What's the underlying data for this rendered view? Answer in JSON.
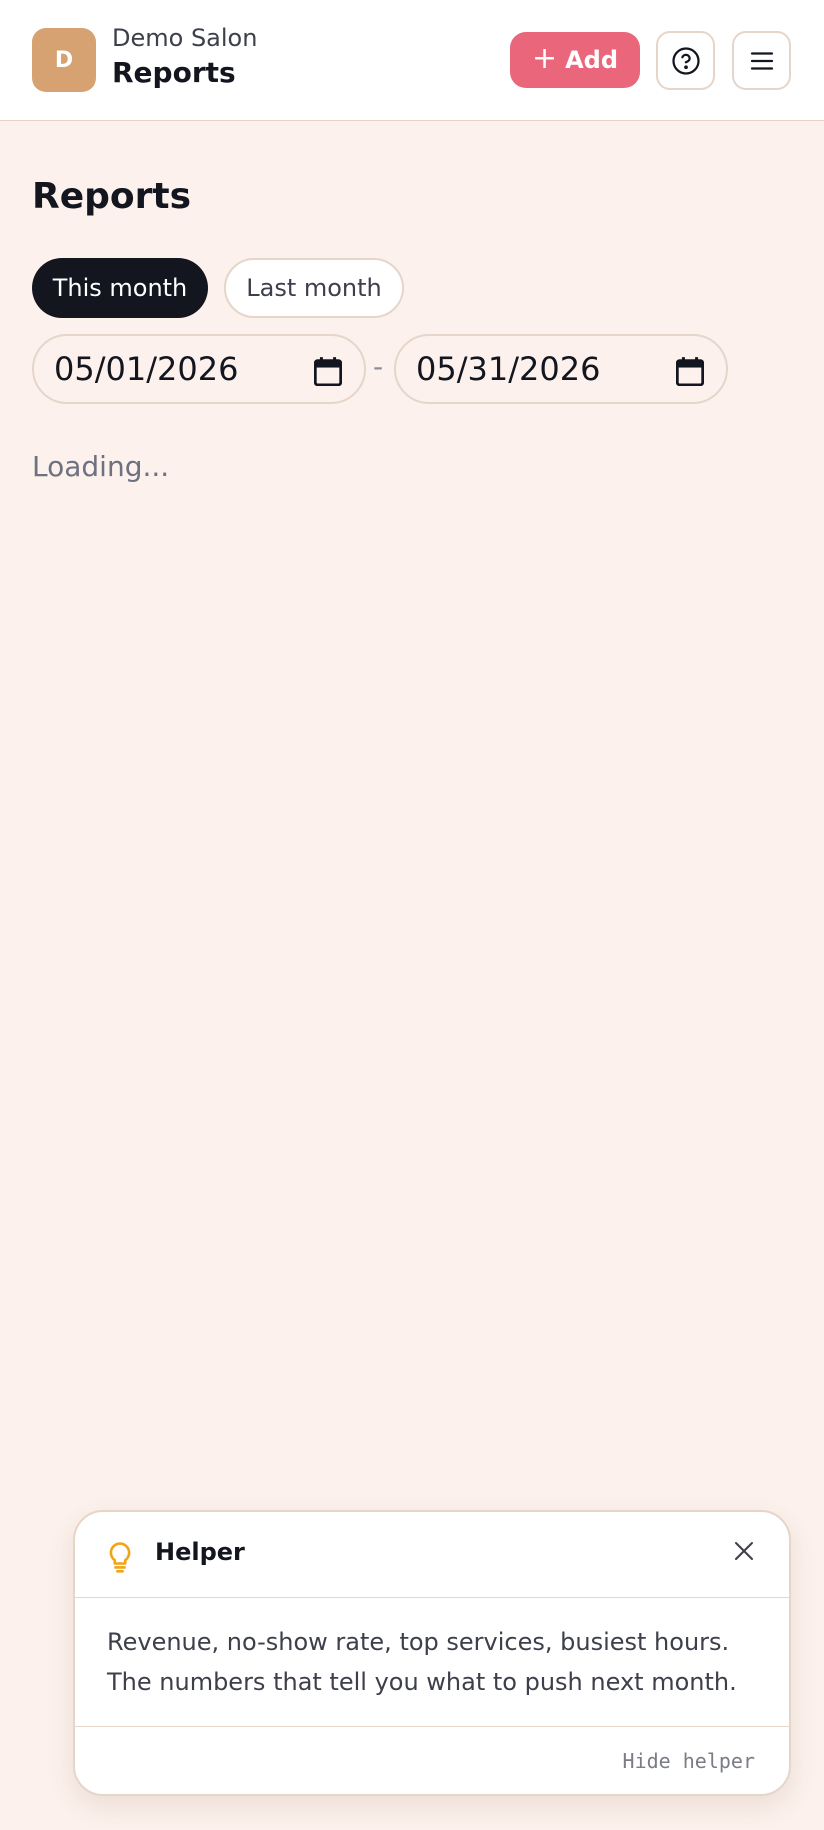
{
  "header": {
    "avatar_initial": "D",
    "salon_name": "Demo Salon",
    "title": "Reports",
    "add_label": "Add",
    "add_icon": "plus-icon",
    "help_icon": "help-circle-icon",
    "menu_icon": "hamburger-menu-icon"
  },
  "main": {
    "title": "Reports",
    "range_options": [
      {
        "label": "This month",
        "selected": true
      },
      {
        "label": "Last month",
        "selected": false
      }
    ],
    "date_start": "05/01/2026",
    "date_separator": "-",
    "date_end": "05/31/2026",
    "status_text": "Loading..."
  },
  "helper": {
    "icon": "lightbulb-icon",
    "title": "Helper",
    "body": "Revenue, no-show rate, top services, busiest hours. The numbers that tell you what to push next month.",
    "hide_label": "Hide helper"
  },
  "colors": {
    "background": "#fcf1ec",
    "accent": "#ea667a",
    "avatar": "#d7a271",
    "dark": "#13151f",
    "bulb": "#f2a413"
  }
}
